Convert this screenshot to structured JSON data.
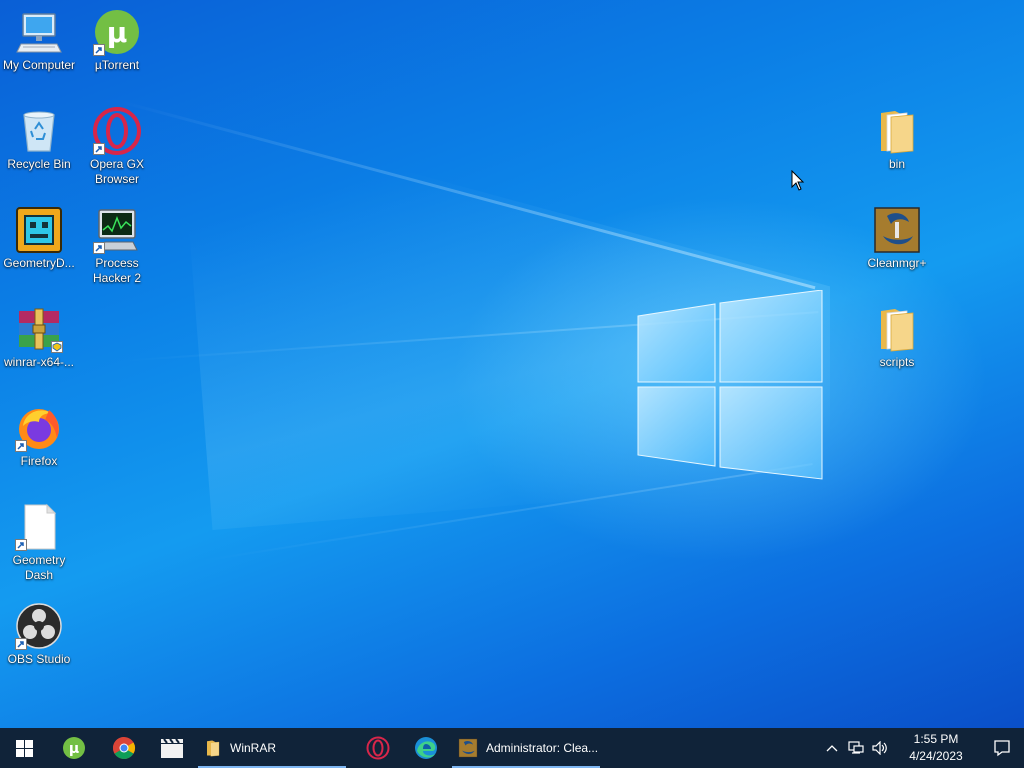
{
  "desktop": {
    "left_icons": [
      {
        "id": "my-computer",
        "label": "My Computer",
        "icon": "computer-icon",
        "shortcut": false
      },
      {
        "id": "utorrent",
        "label": "µTorrent",
        "icon": "utorrent-icon",
        "shortcut": true
      },
      {
        "id": "recycle-bin",
        "label": "Recycle Bin",
        "icon": "recycle-bin-icon",
        "shortcut": false
      },
      {
        "id": "opera-gx",
        "label": "Opera GX Browser",
        "icon": "opera-gx-icon",
        "shortcut": true
      },
      {
        "id": "geometry-dash-app",
        "label": "GeometryD...",
        "icon": "geometry-dash-icon",
        "shortcut": false
      },
      {
        "id": "process-hacker",
        "label": "Process Hacker 2",
        "icon": "process-hacker-icon",
        "shortcut": true
      },
      {
        "id": "winrar-installer",
        "label": "winrar-x64-...",
        "icon": "winrar-icon",
        "shortcut": false
      },
      {
        "id": "firefox",
        "label": "Firefox",
        "icon": "firefox-icon",
        "shortcut": true
      },
      {
        "id": "geometry-dash-shortcut",
        "label": "Geometry Dash",
        "icon": "blank-file-icon",
        "shortcut": true
      },
      {
        "id": "obs-studio",
        "label": "OBS Studio",
        "icon": "obs-icon",
        "shortcut": true
      }
    ],
    "right_icons": [
      {
        "id": "bin-folder",
        "label": "bin",
        "icon": "folder-icon",
        "shortcut": false
      },
      {
        "id": "cleanmgr",
        "label": "Cleanmgr+",
        "icon": "cleanmgr-icon",
        "shortcut": false
      },
      {
        "id": "scripts-folder",
        "label": "scripts",
        "icon": "folder-icon",
        "shortcut": false
      }
    ]
  },
  "taskbar": {
    "pinned": [
      {
        "id": "start",
        "icon": "windows-start-icon"
      },
      {
        "id": "utorrent",
        "icon": "utorrent-icon"
      },
      {
        "id": "chrome",
        "icon": "chrome-icon"
      },
      {
        "id": "media",
        "icon": "clapperboard-icon"
      }
    ],
    "apps": [
      {
        "id": "winrar",
        "label": "WinRAR",
        "icon": "folder-icon",
        "active": true
      },
      {
        "id": "opera",
        "icon": "opera-gx-icon"
      },
      {
        "id": "edge",
        "icon": "edge-icon"
      },
      {
        "id": "cleanmgr-window",
        "label": "Administrator: Clea...",
        "icon": "cleanmgr-icon",
        "active": true
      }
    ],
    "tray": {
      "icons": [
        "chevron-up-icon",
        "network-icon",
        "volume-icon"
      ],
      "time": "1:55 PM",
      "date": "4/24/2023",
      "notification_icon": "notification-icon"
    }
  },
  "colors": {
    "taskbar_bg": "#102339",
    "desktop_accent": "#0b7fe6",
    "taskbar_underline": "#7eb6f2"
  }
}
